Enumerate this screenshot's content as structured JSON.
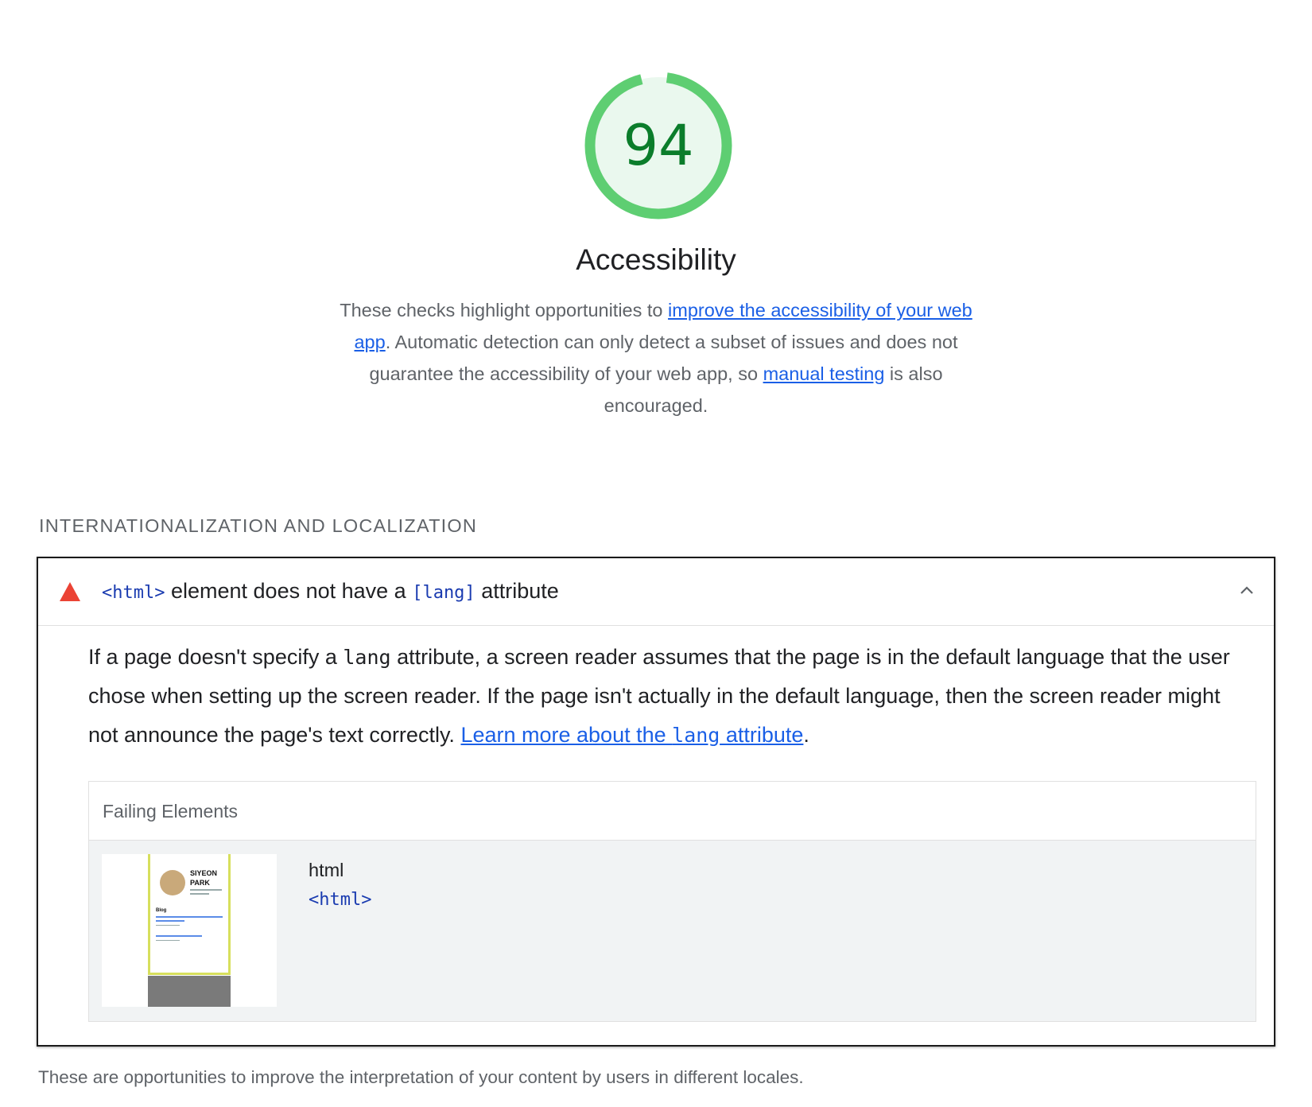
{
  "gauge": {
    "score": "94",
    "fraction": 0.94,
    "ring_color": "#5ece72",
    "fill_color": "#eaf8ee",
    "text_color": "#0b7d2b"
  },
  "category": {
    "title": "Accessibility",
    "desc_before": "These checks highlight opportunities to ",
    "link1": "improve the accessibility of your web app",
    "desc_middle": ". Automatic detection can only detect a subset of issues and does not guarantee the accessibility of your web app, so ",
    "link2": "manual testing",
    "desc_after": " is also encouraged."
  },
  "group": {
    "title": "INTERNATIONALIZATION AND LOCALIZATION",
    "footer": "These are opportunities to improve the interpretation of your content by users in different locales."
  },
  "audit": {
    "title_code1": "<html>",
    "title_mid": " element does not have a ",
    "title_code2": "[lang]",
    "title_end": " attribute",
    "status_icon": "fail-triangle-icon",
    "desc_part1": "If a page doesn't specify a ",
    "desc_code": "lang",
    "desc_part2": " attribute, a screen reader assumes that the page is in the default language that the user chose when setting up the screen reader. If the page isn't actually in the default language, then the screen reader might not announce the page's text correctly. ",
    "learn_before": "Learn more about the ",
    "learn_code": "lang",
    "learn_after": " attribute",
    "desc_end": ".",
    "table_header": "Failing Elements",
    "node": {
      "label": "html",
      "snippet": "<html>",
      "thumb_name": "SIYEON PARK",
      "thumb_blog": "Blog"
    }
  }
}
